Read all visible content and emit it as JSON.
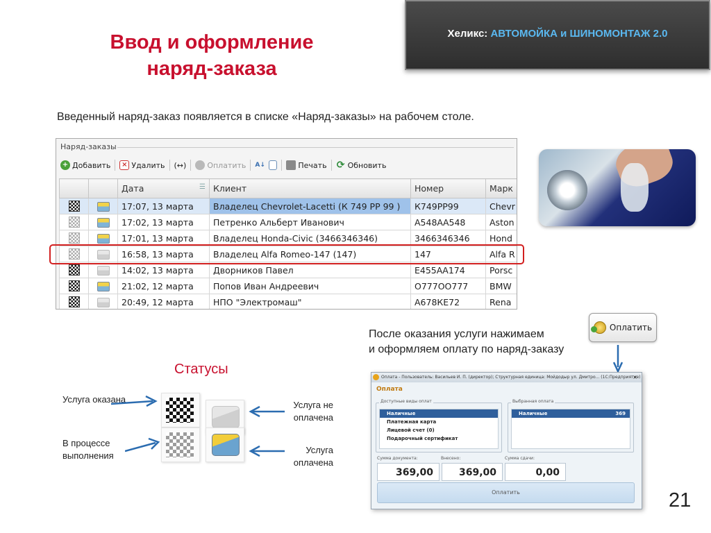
{
  "slide": {
    "title_line1": "Ввод и оформление",
    "title_line2": "наряд-заказа",
    "brand_prefix": "Хеликс:",
    "brand_name": "АВТОМОЙКА и ШИНОМОНТАЖ 2.0",
    "intro": "Введенный наряд-заказ появляется в списке «Наряд-заказы» на рабочем столе.",
    "page_number": "21",
    "colors": {
      "title": "#c8102e",
      "brand_accent": "#5ab8f0",
      "highlight": "#d21f1f"
    }
  },
  "list_window": {
    "title": "Наряд-заказы",
    "toolbar": {
      "add": "Добавить",
      "delete": "Удалить",
      "pay": "Оплатить",
      "print": "Печать",
      "refresh": "Обновить"
    },
    "columns": [
      "",
      "",
      "Дата",
      "Клиент",
      "Номер",
      "Марк"
    ],
    "rows": [
      {
        "flag": "done",
        "reg": "paid",
        "date": "17:07, 13 марта",
        "client": "Владелец Chevrolet-Lacetti (К 749 РР 99 )",
        "number": "К749РР99",
        "make": "Chevr"
      },
      {
        "flag": "progress",
        "reg": "paid",
        "date": "17:02, 13 марта",
        "client": "Петренко Альберт Иванович",
        "number": "А548АА548",
        "make": "Aston"
      },
      {
        "flag": "progress",
        "reg": "paid",
        "date": "17:01, 13 марта",
        "client": "Владелец Honda-Civic (3466346346)",
        "number": "3466346346",
        "make": "Hond"
      },
      {
        "flag": "progress",
        "reg": "unpaid",
        "date": "16:58, 13 марта",
        "client": "Владелец Alfa Romeo-147 (147)",
        "number": "147",
        "make": "Alfa R"
      },
      {
        "flag": "done",
        "reg": "unpaid",
        "date": "14:02, 13 марта",
        "client": "Дворников Павел",
        "number": "Е455АА174",
        "make": "Porsc"
      },
      {
        "flag": "done",
        "reg": "paid",
        "date": "21:02, 12 марта",
        "client": "Попов Иван Андреевич",
        "number": "О777ОО777",
        "make": "BMW"
      },
      {
        "flag": "done",
        "reg": "unpaid",
        "date": "20:49, 12 марта",
        "client": "НПО \"Электромаш\"",
        "number": "А678КЕ72",
        "make": "Rena"
      }
    ]
  },
  "after_service": {
    "line1": "После оказания услуги нажимаем",
    "line2": "и оформляем оплату по наряд-заказу",
    "pay_button": "Оплатить"
  },
  "statuses": {
    "title": "Статусы",
    "service_done": "Услуга оказана",
    "in_progress": "В процессе выполнения",
    "not_paid": "Услуга не оплачена",
    "paid": "Услуга оплачена"
  },
  "payment_window": {
    "titlebar": "Оплата - Пользователь: Васильев И. П. (директор); Структурная единица: Мойдодыр ул. Дмитро... (1С:Предприятие)",
    "close": "×",
    "heading": "Оплата",
    "available_title": "Доступные виды оплат",
    "available": [
      "Наличные",
      "Платежная карта",
      "Лицевой счет (0)",
      "Подарочный сертификат"
    ],
    "selected_title": "Выбранная оплата",
    "selected_item": "Наличные",
    "selected_amount": "369",
    "doc_sum_label": "Сумма документа:",
    "deposited_label": "Внесено:",
    "change_label": "Сумма сдачи:",
    "doc_sum": "369,00",
    "deposited": "369,00",
    "change": "0,00",
    "pay_button": "Оплатить"
  }
}
